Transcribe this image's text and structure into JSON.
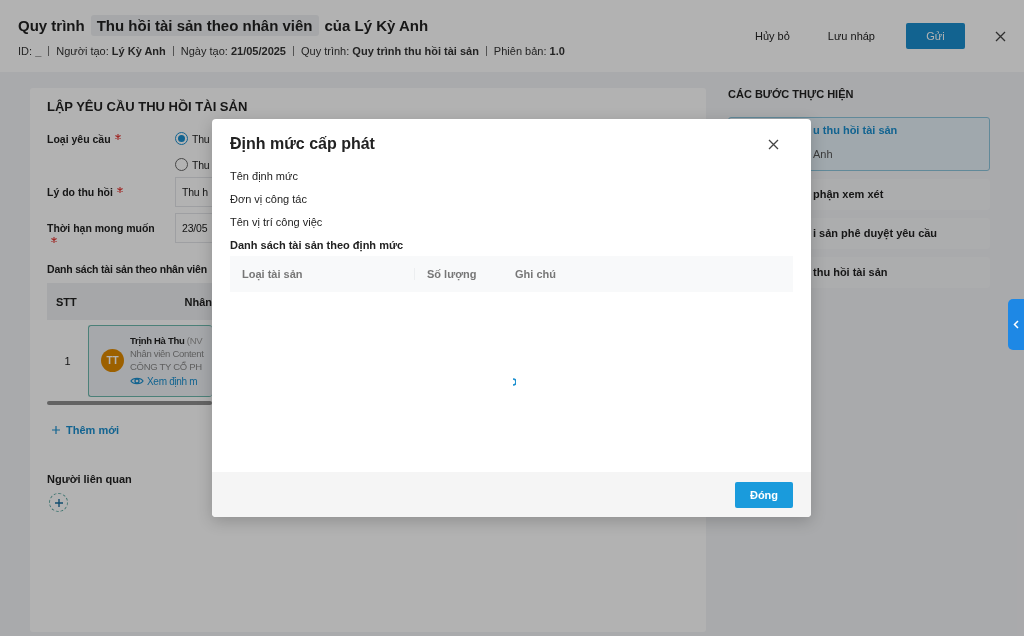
{
  "header": {
    "title_prefix": "Quy trình",
    "title_chip": "Thu hồi tài sản theo nhân viên",
    "title_suffix": "của Lý Kỳ Anh",
    "meta": [
      "ID: **_**",
      "Người tạo: **Lý Kỳ Anh**",
      "Ngày tạo: **21/05/2025**",
      "Quy trình: **Quy trình thu hồi tài sản**",
      "Phiên bản: **1.0**"
    ],
    "buttons": [
      {
        "label": "Hủy bỏ",
        "kind": "text"
      },
      {
        "label": "Lưu nháp",
        "kind": "text"
      },
      {
        "label": "Gửi",
        "kind": "primary"
      }
    ]
  },
  "form": {
    "title": "LẬP YÊU CẦU THU HỒI TÀI SẢN",
    "fields": [
      {
        "label": "Loại yêu cầu",
        "required": true,
        "kind": "radio",
        "options": [
          {
            "label": "Thu",
            "selected": true
          },
          {
            "label": "Thu",
            "selected": false
          }
        ]
      },
      {
        "label": "Lý do thu hồi",
        "required": true,
        "kind": "select",
        "value": "Thu h"
      },
      {
        "label": "Thời hạn mong muốn",
        "required": true,
        "kind": "date",
        "value": "23/05"
      }
    ],
    "assets": {
      "title": "Danh sách tài sản theo nhân viên",
      "columns": [
        "STT",
        "Nhân"
      ],
      "rows": [
        {
          "index": "1",
          "avatar": "TT",
          "name": "Trịnh Hà Thu",
          "code": "(NV",
          "position": "Nhân viên Content",
          "company": "CÔNG TY CỔ PH",
          "link": "Xem định m"
        }
      ],
      "add_label": "Thêm mới"
    },
    "related_label": "Người liên quan"
  },
  "steps": {
    "title": "CÁC BƯỚC THỰC HIỆN",
    "items": [
      {
        "title": "u thu hồi tài sản",
        "subtitle": "Anh",
        "selected": true
      },
      {
        "title": "phận xem xét",
        "selected": false
      },
      {
        "title": "i sản phê duyệt yêu cầu",
        "selected": false
      },
      {
        "title": "thu hồi tài sản",
        "selected": false
      }
    ]
  },
  "dialog": {
    "title": "Định mức cấp phát",
    "fields": [
      "Tên định mức",
      "Đơn vị công tác",
      "Tên vị trí công việc"
    ],
    "list_title": "Danh sách tài sản theo định mức",
    "columns": [
      "Loại tài sản",
      "Số lượng",
      "Ghi chú"
    ],
    "loading": true,
    "close_button": "Đóng"
  }
}
